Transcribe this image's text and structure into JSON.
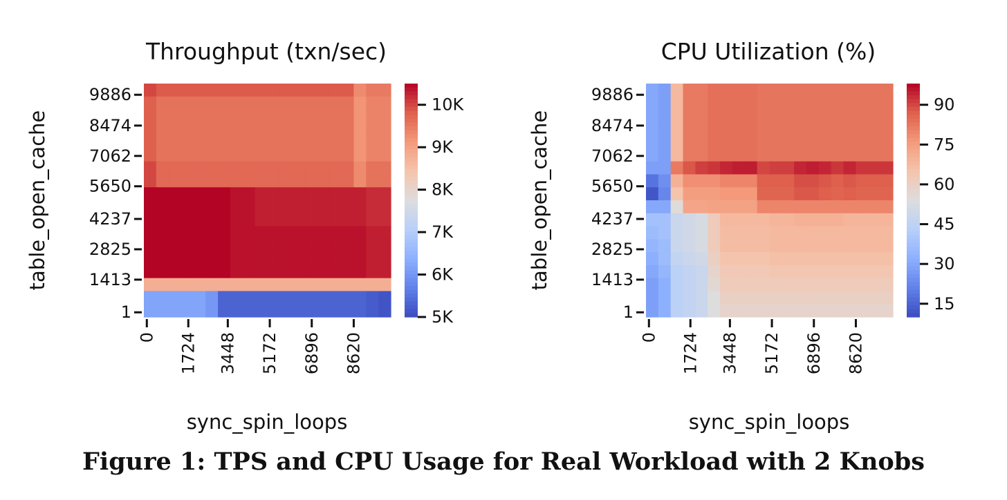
{
  "caption": "Figure 1: TPS and CPU Usage for Real Workload with 2 Knobs",
  "chart_data": [
    {
      "type": "heatmap",
      "title": "Throughput (txn/sec)",
      "xlabel": "sync_spin_loops",
      "ylabel": "table_open_cache",
      "x_ticks": [
        "0",
        "1724",
        "3448",
        "5172",
        "6896",
        "8620"
      ],
      "y_ticks": [
        "9886",
        "8474",
        "7062",
        "5650",
        "4237",
        "2825",
        "1413",
        "1"
      ],
      "colorbar": {
        "min": 5000,
        "max": 10500,
        "ticks": [
          5000,
          6000,
          7000,
          8000,
          9000,
          10000
        ],
        "tick_labels": [
          "5K",
          "6K",
          "7K",
          "8K",
          "9K",
          "10K"
        ]
      },
      "colormap": "coolwarm",
      "grid_rows_top_to_bottom": [
        [
          10000,
          9850,
          9850,
          9850,
          9850,
          9850,
          9850,
          9850,
          9850,
          9850,
          9850,
          9850,
          9850,
          9850,
          9850,
          9850,
          9850,
          9300,
          9500,
          9500
        ],
        [
          9800,
          9600,
          9600,
          9600,
          9600,
          9600,
          9600,
          9600,
          9600,
          9600,
          9600,
          9600,
          9600,
          9600,
          9600,
          9600,
          9600,
          9200,
          9400,
          9400
        ],
        [
          9800,
          9600,
          9600,
          9600,
          9600,
          9600,
          9600,
          9600,
          9600,
          9600,
          9600,
          9600,
          9600,
          9600,
          9600,
          9600,
          9600,
          9200,
          9400,
          9400
        ],
        [
          9800,
          9600,
          9600,
          9600,
          9600,
          9600,
          9600,
          9600,
          9600,
          9600,
          9600,
          9600,
          9600,
          9600,
          9600,
          9600,
          9600,
          9200,
          9400,
          9400
        ],
        [
          9800,
          9600,
          9600,
          9600,
          9600,
          9600,
          9600,
          9600,
          9600,
          9600,
          9600,
          9600,
          9600,
          9600,
          9600,
          9600,
          9600,
          9200,
          9400,
          9400
        ],
        [
          9800,
          9600,
          9600,
          9600,
          9600,
          9600,
          9600,
          9600,
          9600,
          9600,
          9600,
          9600,
          9600,
          9600,
          9600,
          9600,
          9600,
          9200,
          9400,
          9400
        ],
        [
          10000,
          9700,
          9700,
          9700,
          9700,
          9700,
          9700,
          9700,
          9700,
          9700,
          9700,
          9700,
          9700,
          9700,
          9700,
          9700,
          9700,
          9300,
          9600,
          9600
        ],
        [
          10000,
          9700,
          9700,
          9700,
          9700,
          9700,
          9700,
          9700,
          9700,
          9700,
          9700,
          9700,
          9700,
          9700,
          9700,
          9700,
          9700,
          9300,
          9600,
          9600
        ],
        [
          10500,
          10500,
          10500,
          10500,
          10500,
          10500,
          10500,
          10400,
          10400,
          10300,
          10300,
          10300,
          10300,
          10300,
          10300,
          10300,
          10300,
          10300,
          10200,
          10200
        ],
        [
          10500,
          10500,
          10500,
          10500,
          10500,
          10500,
          10500,
          10400,
          10400,
          10300,
          10300,
          10300,
          10300,
          10300,
          10300,
          10300,
          10300,
          10300,
          10200,
          10200
        ],
        [
          10500,
          10500,
          10500,
          10500,
          10500,
          10500,
          10500,
          10400,
          10400,
          10300,
          10300,
          10300,
          10300,
          10300,
          10300,
          10300,
          10300,
          10300,
          10200,
          10200
        ],
        [
          10500,
          10500,
          10500,
          10500,
          10500,
          10500,
          10500,
          10400,
          10400,
          10400,
          10400,
          10400,
          10400,
          10400,
          10400,
          10400,
          10400,
          10400,
          10300,
          10300
        ],
        [
          10500,
          10500,
          10500,
          10500,
          10500,
          10500,
          10500,
          10400,
          10400,
          10400,
          10400,
          10400,
          10400,
          10400,
          10400,
          10400,
          10400,
          10400,
          10300,
          10300
        ],
        [
          10500,
          10500,
          10500,
          10500,
          10500,
          10500,
          10500,
          10400,
          10400,
          10400,
          10400,
          10400,
          10400,
          10400,
          10400,
          10400,
          10400,
          10400,
          10300,
          10300
        ],
        [
          10500,
          10500,
          10500,
          10500,
          10500,
          10500,
          10500,
          10400,
          10400,
          10400,
          10400,
          10400,
          10400,
          10400,
          10400,
          10400,
          10400,
          10400,
          10300,
          10300
        ],
        [
          8800,
          8800,
          8800,
          8800,
          8800,
          8800,
          8800,
          8800,
          8800,
          8800,
          8800,
          8800,
          8800,
          8800,
          8800,
          8800,
          8800,
          8800,
          8800,
          8800
        ],
        [
          6200,
          6200,
          6200,
          6200,
          6200,
          6000,
          5300,
          5300,
          5300,
          5300,
          5300,
          5300,
          5300,
          5300,
          5300,
          5300,
          5300,
          5300,
          5200,
          5100
        ],
        [
          6200,
          6200,
          6200,
          6200,
          6200,
          6000,
          5300,
          5300,
          5300,
          5300,
          5300,
          5300,
          5300,
          5300,
          5300,
          5300,
          5300,
          5300,
          5200,
          5100
        ]
      ]
    },
    {
      "type": "heatmap",
      "title": "CPU Utilization (%)",
      "xlabel": "sync_spin_loops",
      "ylabel": "table_open_cache",
      "x_ticks": [
        "0",
        "1724",
        "3448",
        "5172",
        "6896",
        "8620"
      ],
      "y_ticks": [
        "9886",
        "8474",
        "7062",
        "5650",
        "4237",
        "2825",
        "1413",
        "1"
      ],
      "colorbar": {
        "min": 10,
        "max": 98,
        "ticks": [
          15,
          30,
          45,
          60,
          75,
          90
        ],
        "tick_labels": [
          "15",
          "30",
          "45",
          "60",
          "75",
          "90"
        ]
      },
      "colormap": "coolwarm",
      "grid_rows_top_to_bottom": [
        [
          30,
          28,
          68,
          82,
          82,
          84,
          84,
          84,
          84,
          83,
          83,
          83,
          83,
          83,
          83,
          83,
          83,
          83,
          83,
          83
        ],
        [
          30,
          28,
          68,
          82,
          82,
          84,
          84,
          84,
          84,
          83,
          83,
          83,
          83,
          83,
          83,
          83,
          83,
          83,
          83,
          83
        ],
        [
          30,
          28,
          68,
          82,
          82,
          84,
          84,
          84,
          84,
          83,
          83,
          83,
          83,
          83,
          83,
          83,
          83,
          83,
          83,
          83
        ],
        [
          30,
          28,
          68,
          82,
          82,
          84,
          84,
          84,
          84,
          83,
          83,
          83,
          83,
          83,
          83,
          83,
          83,
          83,
          83,
          83
        ],
        [
          30,
          28,
          68,
          82,
          82,
          84,
          84,
          84,
          84,
          83,
          83,
          83,
          83,
          83,
          83,
          83,
          83,
          83,
          83,
          83
        ],
        [
          30,
          28,
          68,
          82,
          82,
          84,
          84,
          84,
          84,
          83,
          83,
          83,
          83,
          83,
          83,
          83,
          83,
          83,
          83,
          83
        ],
        [
          28,
          28,
          82,
          88,
          91,
          92,
          94,
          95,
          95,
          90,
          91,
          91,
          94,
          95,
          94,
          92,
          94,
          92,
          92,
          92
        ],
        [
          18,
          24,
          70,
          78,
          78,
          78,
          80,
          80,
          80,
          87,
          87,
          87,
          89,
          89,
          88,
          87,
          88,
          87,
          87,
          87
        ],
        [
          12,
          22,
          65,
          75,
          75,
          75,
          76,
          76,
          76,
          86,
          86,
          86,
          88,
          88,
          87,
          86,
          87,
          86,
          86,
          86
        ],
        [
          30,
          30,
          55,
          73,
          73,
          74,
          74,
          74,
          74,
          80,
          80,
          80,
          80,
          80,
          80,
          80,
          80,
          80,
          80,
          80
        ],
        [
          38,
          38,
          48,
          50,
          52,
          62,
          68,
          68,
          68,
          68,
          69,
          69,
          70,
          70,
          70,
          70,
          69,
          69,
          69,
          69
        ],
        [
          36,
          38,
          48,
          50,
          52,
          62,
          67,
          67,
          67,
          67,
          68,
          68,
          68,
          68,
          68,
          68,
          68,
          68,
          68,
          68
        ],
        [
          34,
          36,
          48,
          50,
          52,
          62,
          67,
          67,
          67,
          67,
          68,
          68,
          68,
          68,
          68,
          68,
          68,
          68,
          68,
          68
        ],
        [
          32,
          36,
          46,
          48,
          50,
          60,
          65,
          65,
          65,
          65,
          66,
          66,
          66,
          66,
          66,
          66,
          66,
          66,
          66,
          66
        ],
        [
          30,
          34,
          44,
          46,
          48,
          58,
          63,
          63,
          63,
          63,
          64,
          64,
          64,
          64,
          64,
          64,
          64,
          64,
          64,
          64
        ],
        [
          28,
          32,
          44,
          46,
          48,
          56,
          62,
          62,
          62,
          62,
          62,
          62,
          62,
          62,
          62,
          62,
          62,
          62,
          62,
          62
        ],
        [
          28,
          32,
          44,
          46,
          48,
          54,
          60,
          60,
          60,
          60,
          60,
          60,
          60,
          60,
          60,
          60,
          60,
          60,
          60,
          60
        ],
        [
          28,
          32,
          44,
          46,
          48,
          54,
          58,
          58,
          58,
          58,
          58,
          58,
          58,
          58,
          58,
          58,
          58,
          58,
          58,
          58
        ]
      ]
    }
  ]
}
